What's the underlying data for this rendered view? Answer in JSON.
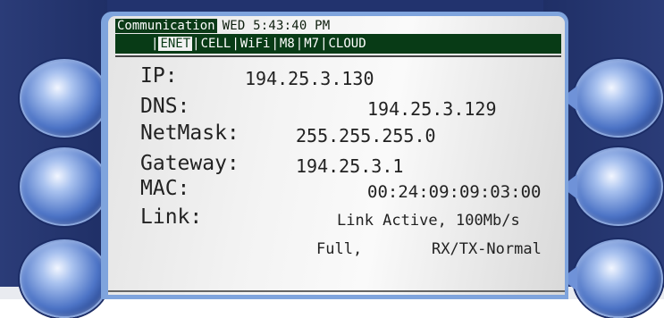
{
  "header": {
    "section_title": "Communication",
    "datetime": "WED 5:43:40 PM"
  },
  "tabs": [
    {
      "label": "ENET",
      "active": true
    },
    {
      "label": "CELL",
      "active": false
    },
    {
      "label": "WiFi",
      "active": false
    },
    {
      "label": "M8",
      "active": false
    },
    {
      "label": "M7",
      "active": false
    },
    {
      "label": "CLOUD",
      "active": false
    }
  ],
  "network": {
    "ip_label": "IP:",
    "ip_value": "194.25.3.130",
    "dns_label": "DNS:",
    "dns_value": "194.25.3.129",
    "netmask_label": "NetMask:",
    "netmask_value": "255.255.255.0",
    "gateway_label": "Gateway:",
    "gateway_value": "194.25.3.1",
    "mac_label": "MAC:",
    "mac_value": "00:24:09:09:03:00",
    "link_label": "Link:",
    "link_value_1": "Link Active, 100Mb/s",
    "link_value_2_a": "Full,",
    "link_value_2_b": "RX/TX-Normal"
  },
  "colors": {
    "bezel": "#22336e",
    "tab_bar": "#083b16",
    "screen": "#f3f3f3"
  }
}
